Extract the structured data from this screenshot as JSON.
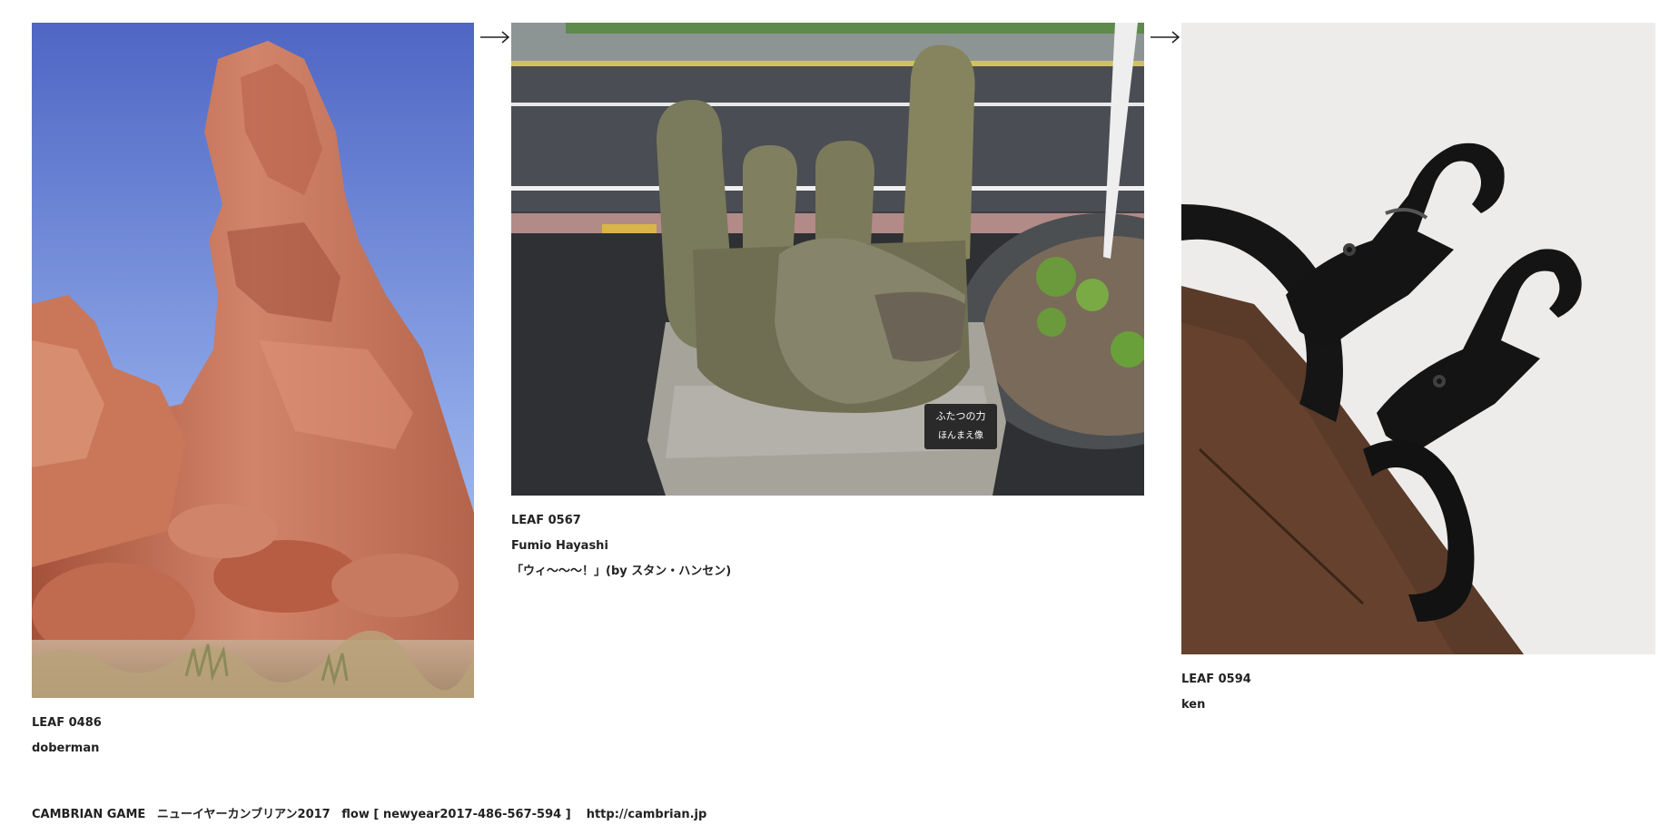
{
  "leaves": [
    {
      "number": "LEAF 0486",
      "author": "doberman",
      "title": ""
    },
    {
      "number": "LEAF 0567",
      "author": "Fumio Hayashi",
      "title": "「ウィ〜〜〜！」(by スタン・ハンセン)"
    },
    {
      "number": "LEAF 0594",
      "author": "ken",
      "title": ""
    }
  ],
  "sign": {
    "line1": "ふたつの力",
    "line2": "ほんまえ像"
  },
  "footer": {
    "site": "CAMBRIAN GAME",
    "game": "ニューイヤーカンブリアン2017",
    "flow": "flow [ newyear2017-486-567-594 ]",
    "url": "http://cambrian.jp"
  },
  "icons": {
    "arrow": "right-arrow-icon"
  },
  "colors": {
    "text": "#222222",
    "background": "#ffffff"
  }
}
